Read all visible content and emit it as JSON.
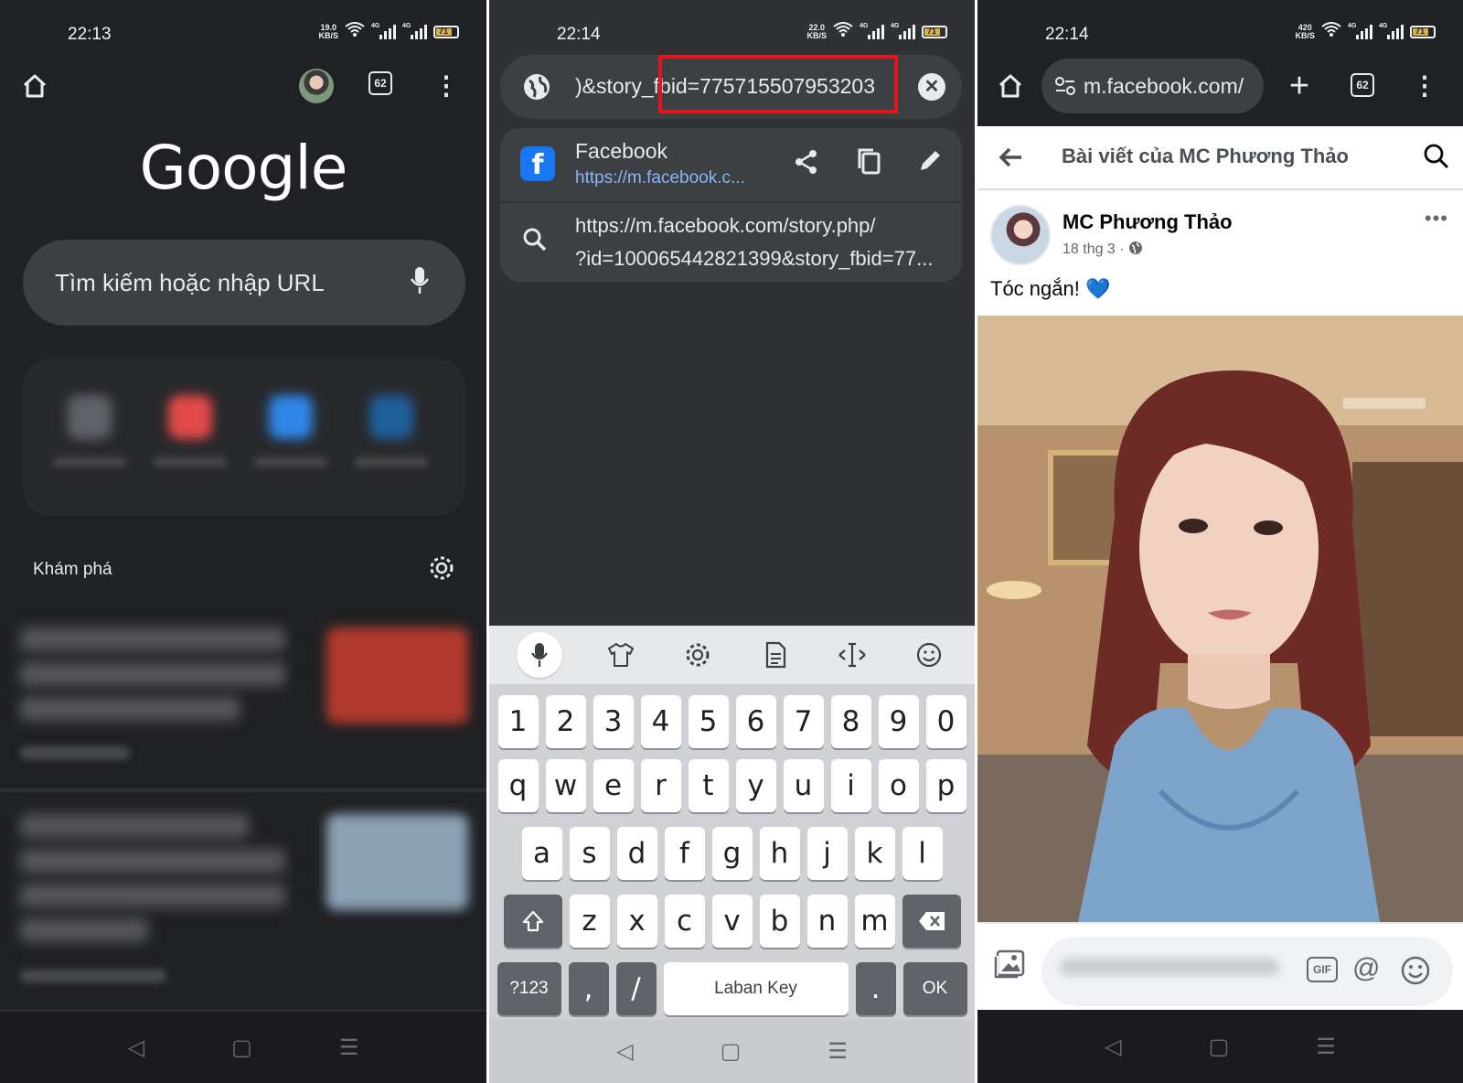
{
  "panel1": {
    "status": {
      "time": "22:13",
      "speed": "19.0",
      "speed_unit": "KB/S",
      "net1": "4G",
      "net2": "4G",
      "battery": "71"
    },
    "tab_count": "62",
    "logo": "Google",
    "search_placeholder": "Tìm kiếm hoặc nhập URL",
    "discover_label": "Khám phá"
  },
  "panel2": {
    "status": {
      "time": "22:14",
      "speed": "22.0",
      "speed_unit": "KB/S",
      "net1": "4G",
      "net2": "4G",
      "battery": "71"
    },
    "url_text": ")&story_fbid=775715507953203",
    "suggestion_site": {
      "title": "Facebook",
      "url": "https://m.facebook.c..."
    },
    "suggestion_search": {
      "line1": "https://m.facebook.com/story.php/",
      "line2": "?id=100065442821399&story_fbid=77..."
    },
    "keyboard": {
      "row_numbers": [
        "1",
        "2",
        "3",
        "4",
        "5",
        "6",
        "7",
        "8",
        "9",
        "0"
      ],
      "row_q": [
        "q",
        "w",
        "e",
        "r",
        "t",
        "y",
        "u",
        "i",
        "o",
        "p"
      ],
      "row_a": [
        "a",
        "s",
        "d",
        "f",
        "g",
        "h",
        "j",
        "k",
        "l"
      ],
      "row_z": [
        "z",
        "x",
        "c",
        "v",
        "b",
        "n",
        "m"
      ],
      "sym_key": "?123",
      "comma_key": ",",
      "slash_key": "/",
      "space_label": "Laban Key",
      "dot_key": ".",
      "ok_key": "OK"
    }
  },
  "panel3": {
    "status": {
      "time": "22:14",
      "speed": "420",
      "speed_unit": "KB/S",
      "net1": "4G",
      "net2": "4G",
      "battery": "71"
    },
    "url_text": "m.facebook.com/",
    "tab_count": "62",
    "header_title": "Bài viết của MC Phương Thảo",
    "post_author": "MC Phương Thảo",
    "post_date": "18 thg 3 ·",
    "post_text": "Tóc ngắn!",
    "post_emoji": "💙",
    "gif_label": "GIF"
  },
  "colors": {
    "dark_bg": "#202124",
    "highlight_box": "#e8141b",
    "link_blue": "#8ab4f8",
    "facebook_blue": "#1877f2"
  }
}
